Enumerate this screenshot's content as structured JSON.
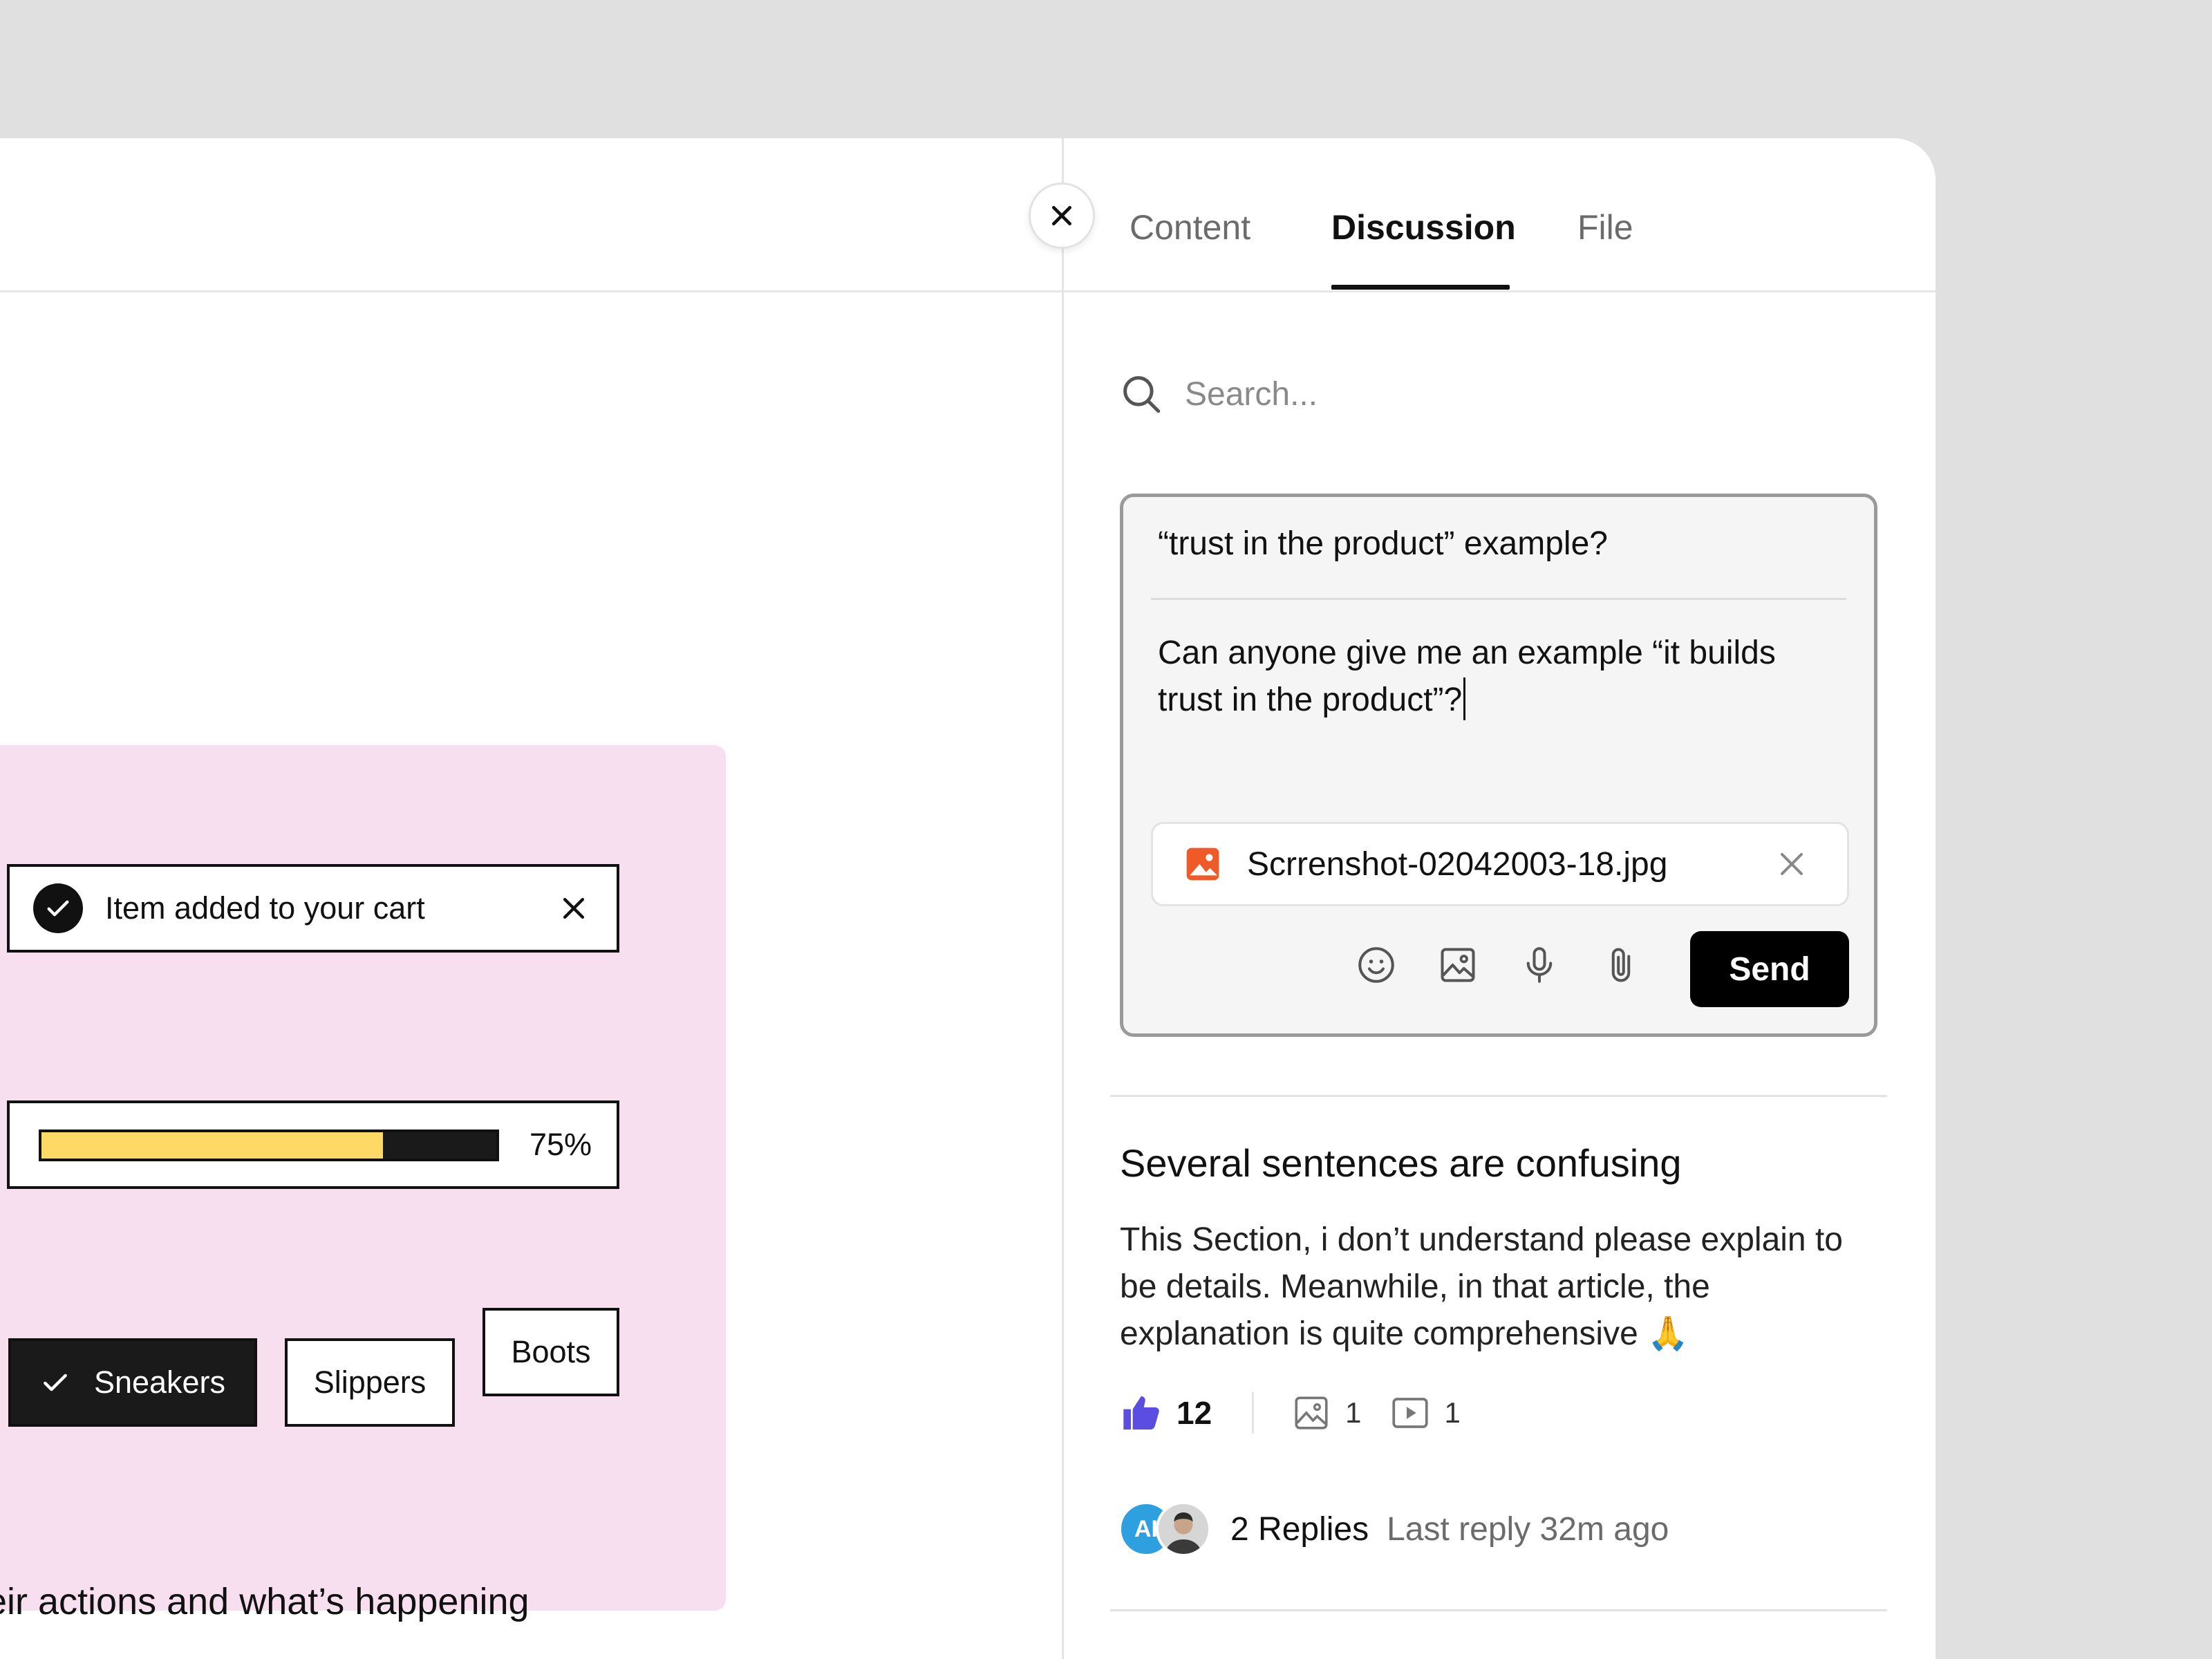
{
  "tabs": [
    {
      "label": "Content",
      "active": false
    },
    {
      "label": "Discussion",
      "active": true
    },
    {
      "label": "File",
      "active": false
    }
  ],
  "search": {
    "placeholder": "Search...",
    "icon": "search-icon"
  },
  "composer": {
    "title": "“trust in the product” example?",
    "body": "Can anyone give me an example “it builds trust in the product”?",
    "attachment": {
      "name": "Scrrenshot-02042003-18.jpg",
      "icon": "image-file-icon",
      "icon_color": "#f05a28"
    },
    "tools": [
      "emoji-icon",
      "image-icon",
      "microphone-icon",
      "paperclip-icon"
    ],
    "send_label": "Send"
  },
  "discussion": {
    "title": "Several sentences are confusing",
    "body": "This Section, i don’t understand please explain to be details. Meanwhile, in that article, the explanation is quite comprehensive 🙏",
    "likes": "12",
    "like_color": "#5b4de0",
    "images": "1",
    "videos": "1",
    "avatar_initials": "AI",
    "replies": "2 Replies",
    "last_reply": "Last reply 32m ago"
  },
  "preview": {
    "panel_color": "#f8dff0",
    "toast_text": "Item added to your cart",
    "progress": {
      "value": 0.75,
      "label": "75%",
      "fill_color": "#ffd966"
    },
    "chips": [
      {
        "label": "Sneakers",
        "selected": true
      },
      {
        "label": "Slippers",
        "selected": false
      },
      {
        "label": "Boots",
        "selected": false
      }
    ],
    "bottom_text": "eir actions and what’s happening"
  }
}
